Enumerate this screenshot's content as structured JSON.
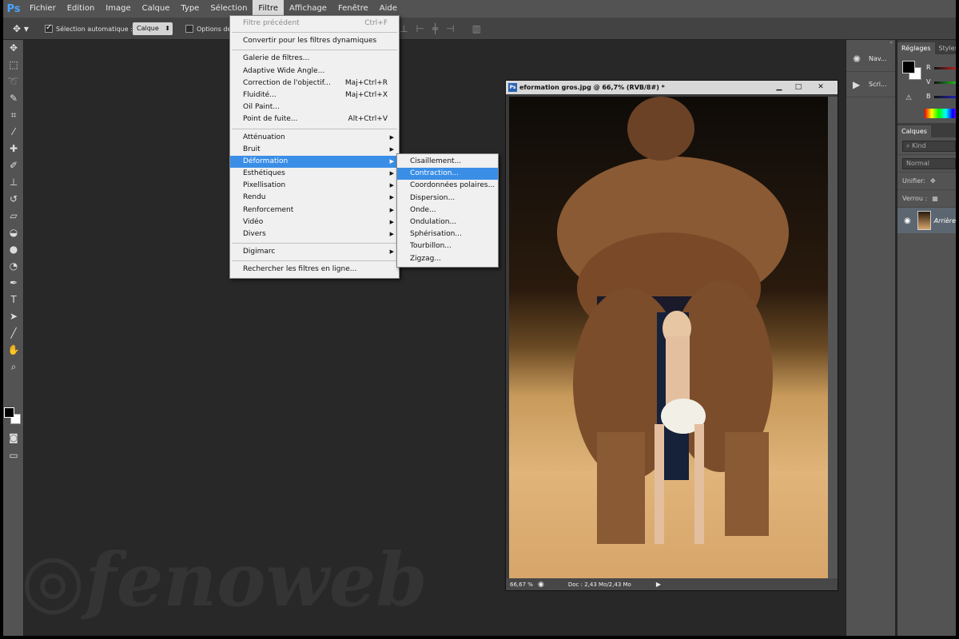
{
  "menubar": {
    "logo": "Ps",
    "items": [
      "Fichier",
      "Edition",
      "Image",
      "Calque",
      "Type",
      "Sélection",
      "Filtre",
      "Affichage",
      "Fenêtre",
      "Aide"
    ],
    "active_index": 6
  },
  "options_bar": {
    "auto_select_label": "Sélection automatique :",
    "auto_select_checked": true,
    "auto_select_value": "Calque",
    "transform_options_label": "Options de"
  },
  "filter_menu": {
    "items": [
      {
        "label": "Filtre précédent",
        "shortcut": "Ctrl+F",
        "disabled": true
      },
      {
        "sep": true
      },
      {
        "label": "Convertir pour les filtres dynamiques"
      },
      {
        "sep": true
      },
      {
        "label": "Galerie de filtres..."
      },
      {
        "label": "Adaptive Wide Angle..."
      },
      {
        "label": "Correction de l'objectif...",
        "shortcut": "Maj+Ctrl+R"
      },
      {
        "label": "Fluidité...",
        "shortcut": "Maj+Ctrl+X"
      },
      {
        "label": "Oil Paint..."
      },
      {
        "label": "Point de fuite...",
        "shortcut": "Alt+Ctrl+V"
      },
      {
        "sep": true
      },
      {
        "label": "Atténuation",
        "submenu": true
      },
      {
        "label": "Bruit",
        "submenu": true
      },
      {
        "label": "Déformation",
        "submenu": true,
        "highlighted": true
      },
      {
        "label": "Esthétiques",
        "submenu": true
      },
      {
        "label": "Pixellisation",
        "submenu": true
      },
      {
        "label": "Rendu",
        "submenu": true
      },
      {
        "label": "Renforcement",
        "submenu": true
      },
      {
        "label": "Vidéo",
        "submenu": true
      },
      {
        "label": "Divers",
        "submenu": true
      },
      {
        "sep": true
      },
      {
        "label": "Digimarc",
        "submenu": true
      },
      {
        "sep": true
      },
      {
        "label": "Rechercher les filtres en ligne..."
      }
    ]
  },
  "distort_submenu": {
    "items": [
      {
        "label": "Cisaillement..."
      },
      {
        "label": "Contraction...",
        "highlighted": true
      },
      {
        "label": "Coordonnées polaires..."
      },
      {
        "label": "Dispersion..."
      },
      {
        "label": "Onde..."
      },
      {
        "label": "Ondulation..."
      },
      {
        "label": "Sphérisation..."
      },
      {
        "label": "Tourbillon..."
      },
      {
        "label": "Zigzag..."
      }
    ]
  },
  "document": {
    "ps_icon": "Ps",
    "title": "eformation gros.jpg @ 66,7% (RVB/8#) *",
    "zoom": "66,67 %",
    "doc_info": "Doc : 2,43 Mo/2,43 Mo"
  },
  "collapsed_panels": {
    "items": [
      "Nav...",
      "Scri..."
    ]
  },
  "right_panel": {
    "tabs": [
      "Réglages",
      "Styles"
    ],
    "color_labels": [
      "R",
      "V",
      "B"
    ],
    "layers_tab": "Calques",
    "kind_label": "Kind",
    "blend_mode": "Normal",
    "unify_label": "Unifier:",
    "lock_label": "Verrou :",
    "layer_name": "Arrière"
  },
  "watermark": "fenoweb"
}
